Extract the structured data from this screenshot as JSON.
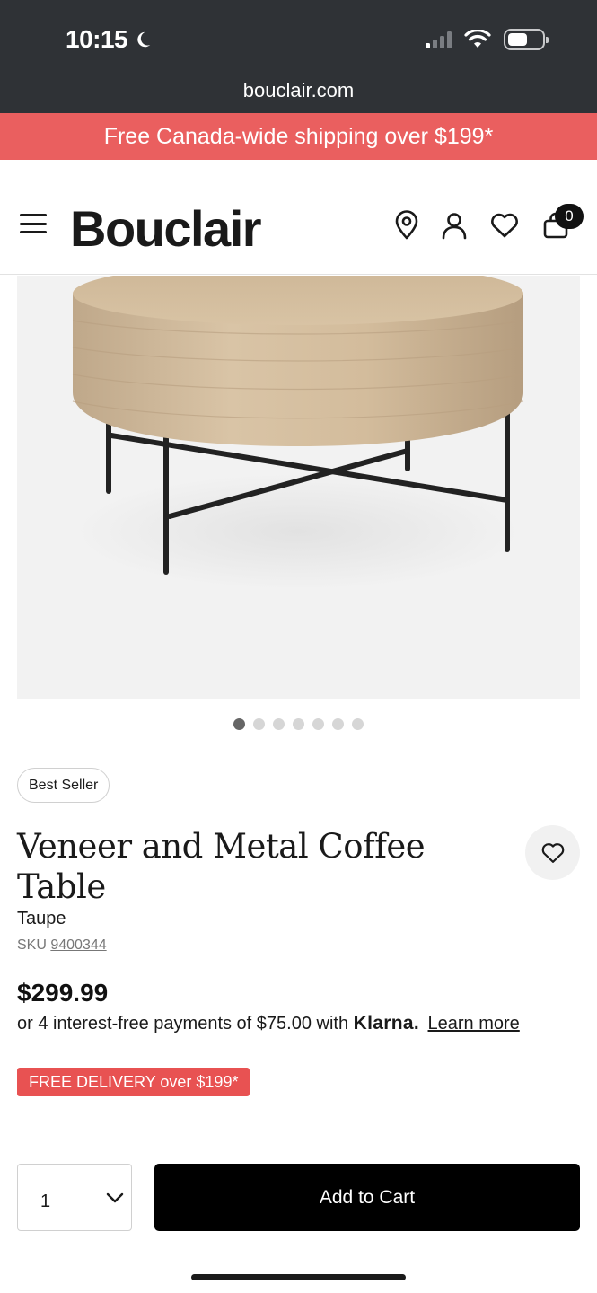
{
  "status_bar": {
    "time": "10:15",
    "url": "bouclair.com"
  },
  "promo_banner": {
    "text": "Free Canada-wide shipping over $199*"
  },
  "header": {
    "logo": "Bouclair",
    "cart_count": "0"
  },
  "carousel": {
    "total": 7,
    "active_index": 0
  },
  "product": {
    "badge": "Best Seller",
    "title": "Veneer and Metal Coffee Table",
    "color": "Taupe",
    "sku_label": "SKU",
    "sku": "9400344",
    "price": "$299.99",
    "installments_text": "or 4 interest-free payments of $75.00 with",
    "klarna": "Klarna.",
    "learn_more": "Learn more",
    "delivery_badge": "FREE DELIVERY over $199*",
    "quantity": "1",
    "add_to_cart": "Add to Cart"
  },
  "colors": {
    "promo": "#ea5f5f",
    "delivery_badge": "#e85252",
    "browser_chrome": "#2f3236"
  }
}
